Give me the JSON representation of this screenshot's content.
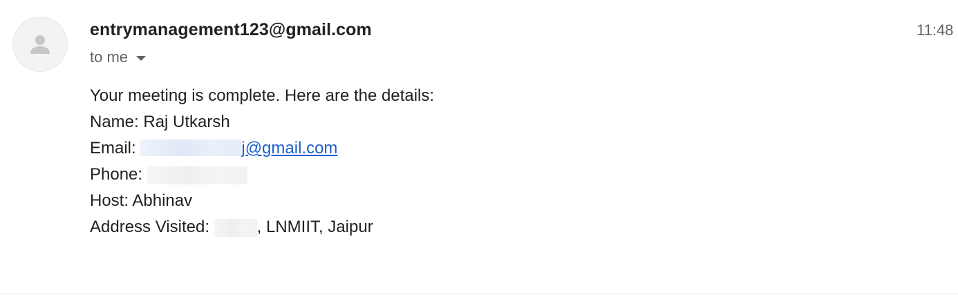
{
  "sender": {
    "email": "entrymanagement123@gmail.com"
  },
  "timestamp": "11:48",
  "recipient": {
    "label": "to me"
  },
  "body": {
    "intro": "Your meeting is complete. Here are the details:",
    "name_line": "Name: Raj Utkarsh",
    "email_label": "Email: ",
    "email_visible_suffix": "j@gmail.com",
    "phone_label": "Phone: ",
    "host_line": "Host: Abhinav",
    "address_label": "Address Visited: ",
    "address_visible_suffix": ", LNMIIT, Jaipur"
  },
  "colors": {
    "link": "#1a5fd0",
    "text": "#202124",
    "muted": "#5f6368",
    "avatar_bg": "#f1f3f4"
  }
}
